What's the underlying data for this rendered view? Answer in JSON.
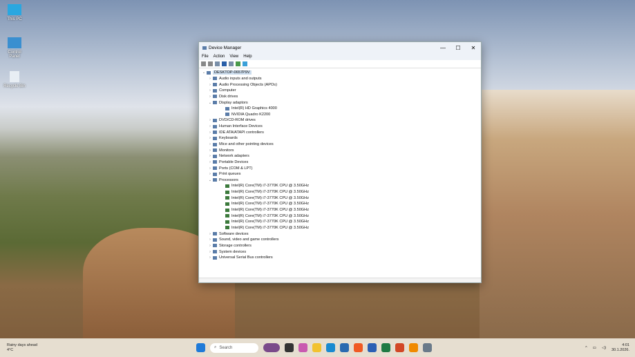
{
  "desktop": {
    "icons": [
      {
        "label": "This PC"
      },
      {
        "label": "Control Panel"
      },
      {
        "label": "Recycle Bin"
      }
    ]
  },
  "window": {
    "title": "Device Manager",
    "controls": {
      "minimize": "—",
      "maximize": "☐",
      "close": "✕"
    },
    "menu": [
      "File",
      "Action",
      "View",
      "Help"
    ],
    "root": "DESKTOP-0657P9V",
    "tree": [
      {
        "label": "Audio inputs and outputs",
        "exp": "›",
        "level": 1
      },
      {
        "label": "Audio Processing Objects (APOs)",
        "exp": "›",
        "level": 1
      },
      {
        "label": "Computer",
        "exp": "›",
        "level": 1
      },
      {
        "label": "Disk drives",
        "exp": "›",
        "level": 1
      },
      {
        "label": "Display adaptors",
        "exp": "⌄",
        "level": 1
      },
      {
        "label": "Intel(R) HD Graphics 4000",
        "exp": "",
        "level": 2
      },
      {
        "label": "NVIDIA Quadro K2200",
        "exp": "",
        "level": 2
      },
      {
        "label": "DVD/CD-ROM drives",
        "exp": "›",
        "level": 1
      },
      {
        "label": "Human Interface Devices",
        "exp": "›",
        "level": 1
      },
      {
        "label": "IDE ATA/ATAPI controllers",
        "exp": "›",
        "level": 1
      },
      {
        "label": "Keyboards",
        "exp": "›",
        "level": 1
      },
      {
        "label": "Mice and other pointing devices",
        "exp": "›",
        "level": 1
      },
      {
        "label": "Monitors",
        "exp": "›",
        "level": 1
      },
      {
        "label": "Network adapters",
        "exp": "›",
        "level": 1
      },
      {
        "label": "Portable Devices",
        "exp": "›",
        "level": 1
      },
      {
        "label": "Ports (COM & LPT)",
        "exp": "›",
        "level": 1
      },
      {
        "label": "Print queues",
        "exp": "›",
        "level": 1
      },
      {
        "label": "Processors",
        "exp": "⌄",
        "level": 1
      },
      {
        "label": "Intel(R) Core(TM) i7-3770K CPU @ 3.50GHz",
        "exp": "",
        "level": 2,
        "cpu": true
      },
      {
        "label": "Intel(R) Core(TM) i7-3770K CPU @ 3.50GHz",
        "exp": "",
        "level": 2,
        "cpu": true
      },
      {
        "label": "Intel(R) Core(TM) i7-3770K CPU @ 3.50GHz",
        "exp": "",
        "level": 2,
        "cpu": true
      },
      {
        "label": "Intel(R) Core(TM) i7-3770K CPU @ 3.50GHz",
        "exp": "",
        "level": 2,
        "cpu": true
      },
      {
        "label": "Intel(R) Core(TM) i7-3770K CPU @ 3.50GHz",
        "exp": "",
        "level": 2,
        "cpu": true
      },
      {
        "label": "Intel(R) Core(TM) i7-3770K CPU @ 3.50GHz",
        "exp": "",
        "level": 2,
        "cpu": true
      },
      {
        "label": "Intel(R) Core(TM) i7-3770K CPU @ 3.50GHz",
        "exp": "",
        "level": 2,
        "cpu": true
      },
      {
        "label": "Intel(R) Core(TM) i7-3770K CPU @ 3.50GHz",
        "exp": "",
        "level": 2,
        "cpu": true
      },
      {
        "label": "Software devices",
        "exp": "›",
        "level": 1
      },
      {
        "label": "Sound, video and game controllers",
        "exp": "›",
        "level": 1
      },
      {
        "label": "Storage controllers",
        "exp": "›",
        "level": 1
      },
      {
        "label": "System devices",
        "exp": "›",
        "level": 1
      },
      {
        "label": "Universal Serial Bus controllers",
        "exp": "›",
        "level": 1
      }
    ]
  },
  "taskbar": {
    "weather": {
      "title": "Rainy days ahead",
      "temp": "4°C"
    },
    "search_placeholder": "Search",
    "apps": [
      {
        "name": "widget",
        "color": "#7a4a8a"
      },
      {
        "name": "task-view",
        "color": "#333"
      },
      {
        "name": "copilot",
        "color": "#c95ab0"
      },
      {
        "name": "file-explorer",
        "color": "#f2c230"
      },
      {
        "name": "edge",
        "color": "#1a8ad0"
      },
      {
        "name": "store",
        "color": "#2a6ab0"
      },
      {
        "name": "brave",
        "color": "#f05a24"
      },
      {
        "name": "word",
        "color": "#2b5fb4"
      },
      {
        "name": "excel",
        "color": "#1e7a43"
      },
      {
        "name": "powerpoint",
        "color": "#d24726"
      },
      {
        "name": "vlc",
        "color": "#f08a00"
      },
      {
        "name": "device-manager",
        "color": "#6a7a8a"
      }
    ],
    "time": "4:01",
    "date": "30.1.2026."
  }
}
